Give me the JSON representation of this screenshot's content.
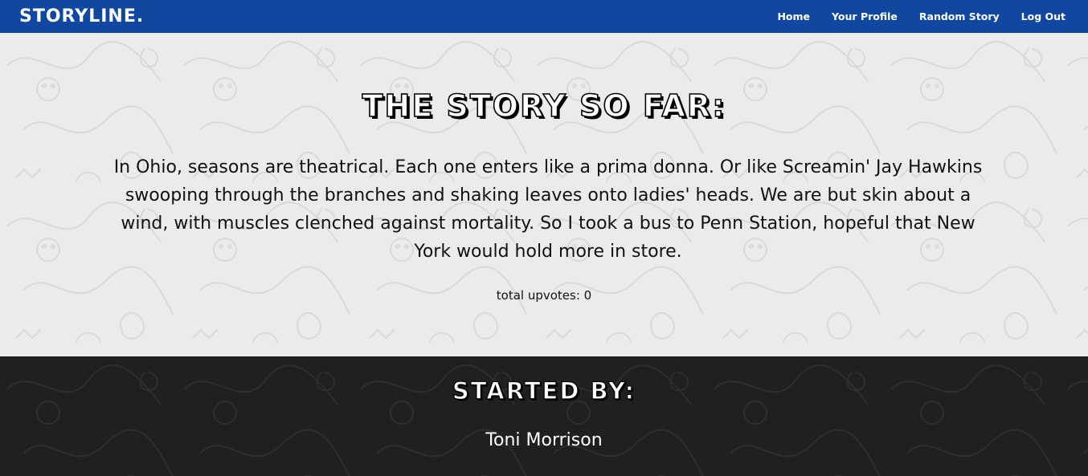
{
  "nav": {
    "brand": "STORYLINE.",
    "links": [
      {
        "label": "Home"
      },
      {
        "label": "Your Profile"
      },
      {
        "label": "Random Story"
      },
      {
        "label": "Log Out"
      }
    ],
    "bg_color": "#0f47a1"
  },
  "story": {
    "heading": "THE STORY SO FAR:",
    "text": "In Ohio, seasons are theatrical. Each one enters like a prima donna. Or like Screamin' Jay Hawkins swooping through the branches and shaking leaves onto ladies' heads. We are but skin about a wind, with muscles clenched against mortality. So I took a bus to Penn Station, hopeful that New York would hold more in store.",
    "upvotes_label": "total upvotes: 0",
    "bg_color": "#ebebeb"
  },
  "author": {
    "heading": "STARTED BY:",
    "name": "Toni Morrison",
    "bg_color": "#202020"
  }
}
